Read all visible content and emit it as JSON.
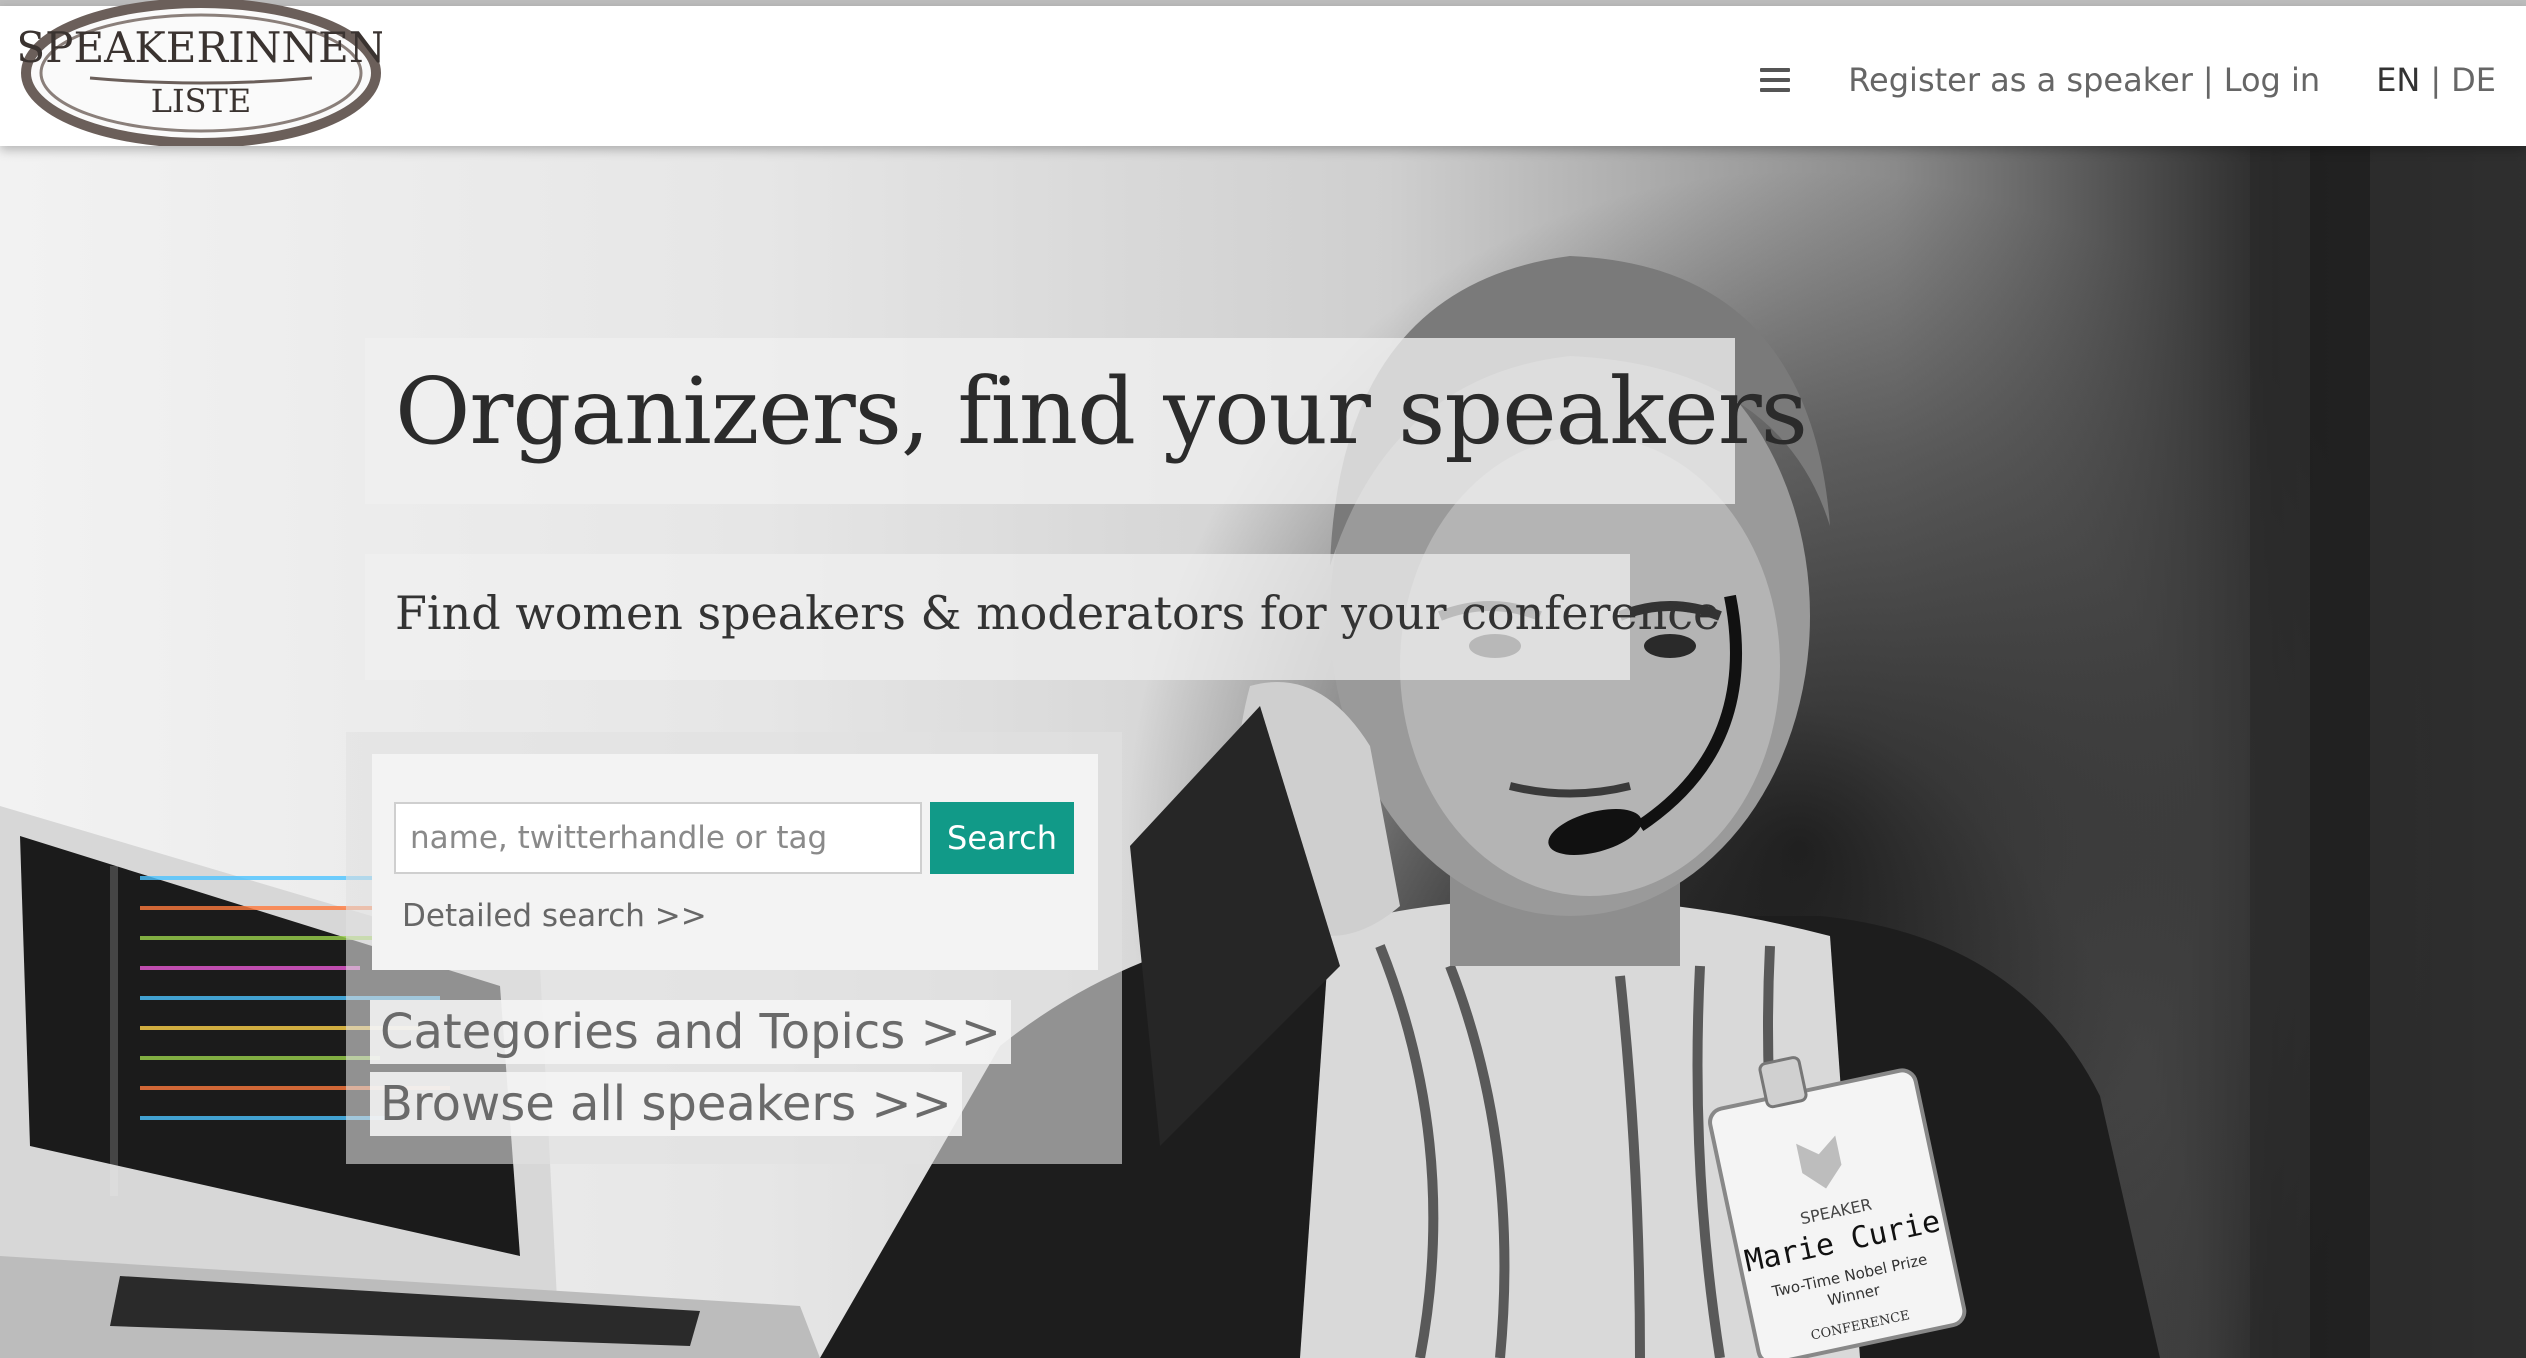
{
  "header": {
    "logo_text_top": "SPEAKERINNEN",
    "logo_text_bottom": "LISTE",
    "menu_icon": "hamburger-icon",
    "register_label": "Register as a speaker",
    "separator": "|",
    "login_label": "Log in",
    "lang_en": "EN",
    "lang_sep": "|",
    "lang_de": "DE"
  },
  "hero": {
    "title": "Organizers, find your speakers",
    "subtitle": "Find women speakers & moderators for your conference",
    "badge": {
      "role": "SPEAKER",
      "name": "Marie Curie",
      "caption_line1": "Two-Time Nobel Prize",
      "caption_line2": "Winner",
      "footer": "CONFERENCE"
    }
  },
  "search": {
    "placeholder": "name, twitterhandle or tag",
    "value": "",
    "button_label": "Search",
    "detailed_link": "Detailed search >>"
  },
  "links": {
    "categories": "Categories and Topics >>",
    "browse": "Browse all speakers >>"
  },
  "colors": {
    "accent": "#119a88",
    "nav_text": "#666666",
    "title_text": "#2b2b2b"
  }
}
